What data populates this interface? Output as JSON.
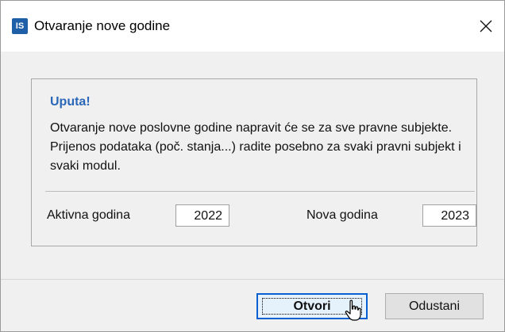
{
  "window": {
    "icon_text": "IS",
    "title": "Otvaranje nove godine"
  },
  "info": {
    "heading": "Uputa!",
    "text": "Otvaranje nove poslovne godine napravit će se za sve pravne subjekte. Prijenos podataka (poč. stanja...) radite posebno za svaki pravni subjekt i svaki modul."
  },
  "fields": {
    "active_label": "Aktivna godina",
    "active_value": "2022",
    "new_label": "Nova godina",
    "new_value": "2023"
  },
  "buttons": {
    "open_label": "Otvori",
    "cancel_label": "Odustani"
  },
  "colors": {
    "accent": "#2a67b8",
    "default_button_border": "#0a5fd0"
  },
  "icons": {
    "app": "app-icon",
    "close": "close-icon",
    "cursor": "hand-cursor-icon"
  }
}
